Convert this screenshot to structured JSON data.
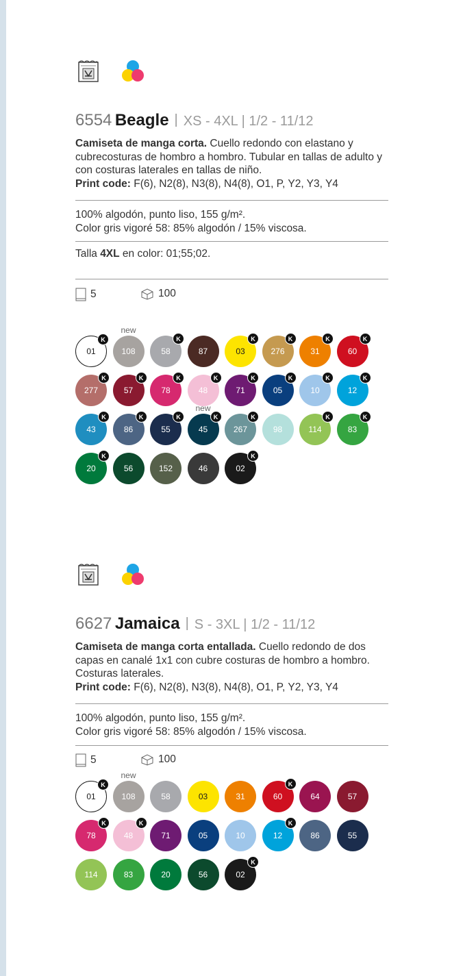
{
  "colors": {
    "stripe": "#d5e1ea",
    "rule": "#9a9a9a",
    "k_badge": "#111111"
  },
  "products": [
    {
      "icons": [
        "label-icon",
        "cmyk-color-icon"
      ],
      "code": "6554",
      "name": "Beagle",
      "separator": "|",
      "sizes": "XS - 4XL | 1/2 - 11/12",
      "desc_bold": "Camiseta de manga corta.",
      "desc_rest": " Cuello redondo con elastano y cubrecosturas de hombro a hombro. Tubular en tallas de adulto y con costuras laterales en tallas de niño.",
      "print_label": "Print code:",
      "print_value": " F(6), N2(8), N3(8), N4(8), O1, P, Y2, Y3, Y4",
      "fabric_line1": "100% algodón, punto liso, 155 g/m².",
      "fabric_line2": "Color gris vigoré 58: 85% algodón / 15% viscosa.",
      "talla_prefix": "Talla ",
      "talla_bold": "4XL",
      "talla_suffix": " en color: 01;55;02.",
      "pack_units": "5",
      "box_units": "100",
      "swatches": [
        {
          "code": "01",
          "color": "#ffffff",
          "text": "#1a1a1a",
          "k": true,
          "new": false
        },
        {
          "code": "108",
          "color": "#a7a3a0",
          "text": "#ffffff",
          "k": false,
          "new": true
        },
        {
          "code": "58",
          "color": "#a8a9ad",
          "text": "#ffffff",
          "k": true,
          "new": false
        },
        {
          "code": "87",
          "color": "#4b2a24",
          "text": "#ffffff",
          "k": false,
          "new": false
        },
        {
          "code": "03",
          "color": "#fde400",
          "text": "#1a1a1a",
          "k": true,
          "new": false
        },
        {
          "code": "276",
          "color": "#c59a50",
          "text": "#ffffff",
          "k": true,
          "new": false
        },
        {
          "code": "31",
          "color": "#ee8000",
          "text": "#ffffff",
          "k": true,
          "new": false
        },
        {
          "code": "60",
          "color": "#cf1020",
          "text": "#ffffff",
          "k": true,
          "new": false
        },
        {
          "code": "277",
          "color": "#b46e6a",
          "text": "#ffffff",
          "k": true,
          "new": false
        },
        {
          "code": "57",
          "color": "#8a1a30",
          "text": "#ffffff",
          "k": true,
          "new": false
        },
        {
          "code": "78",
          "color": "#d6296f",
          "text": "#ffffff",
          "k": true,
          "new": false
        },
        {
          "code": "48",
          "color": "#f4bfd6",
          "text": "#ffffff",
          "k": true,
          "new": false
        },
        {
          "code": "71",
          "color": "#6e1b72",
          "text": "#ffffff",
          "k": true,
          "new": false
        },
        {
          "code": "05",
          "color": "#0a3f7e",
          "text": "#ffffff",
          "k": true,
          "new": false
        },
        {
          "code": "10",
          "color": "#9fc6ea",
          "text": "#ffffff",
          "k": true,
          "new": false
        },
        {
          "code": "12",
          "color": "#00a3db",
          "text": "#ffffff",
          "k": true,
          "new": false
        },
        {
          "code": "43",
          "color": "#1f8ec0",
          "text": "#ffffff",
          "k": true,
          "new": false
        },
        {
          "code": "86",
          "color": "#4d6584",
          "text": "#ffffff",
          "k": true,
          "new": false
        },
        {
          "code": "55",
          "color": "#1b2d4d",
          "text": "#ffffff",
          "k": true,
          "new": false
        },
        {
          "code": "45",
          "color": "#063a4f",
          "text": "#ffffff",
          "k": true,
          "new": true
        },
        {
          "code": "267",
          "color": "#6c959a",
          "text": "#ffffff",
          "k": true,
          "new": false
        },
        {
          "code": "98",
          "color": "#b4e0dc",
          "text": "#ffffff",
          "k": false,
          "new": false
        },
        {
          "code": "114",
          "color": "#93c456",
          "text": "#ffffff",
          "k": true,
          "new": false
        },
        {
          "code": "83",
          "color": "#35a541",
          "text": "#ffffff",
          "k": true,
          "new": false
        },
        {
          "code": "20",
          "color": "#007a3c",
          "text": "#ffffff",
          "k": true,
          "new": false
        },
        {
          "code": "56",
          "color": "#0c4a2d",
          "text": "#ffffff",
          "k": false,
          "new": false
        },
        {
          "code": "152",
          "color": "#56604a",
          "text": "#ffffff",
          "k": false,
          "new": false
        },
        {
          "code": "46",
          "color": "#3a3a3a",
          "text": "#ffffff",
          "k": false,
          "new": false
        },
        {
          "code": "02",
          "color": "#1a1a1a",
          "text": "#ffffff",
          "k": true,
          "new": false
        }
      ]
    },
    {
      "icons": [
        "label-icon",
        "cmyk-color-icon"
      ],
      "code": "6627",
      "name": "Jamaica",
      "separator": "|",
      "sizes": "S - 3XL | 1/2 - 11/12",
      "desc_bold": "Camiseta de manga corta entallada.",
      "desc_rest": " Cuello redondo de dos capas en canalé 1x1 con cubre costuras de hombro a hombro. Costuras laterales.",
      "print_label": "Print code:",
      "print_value": " F(6), N2(8), N3(8), N4(8), O1, P, Y2, Y3, Y4",
      "fabric_line1": "100% algodón, punto liso, 155 g/m².",
      "fabric_line2": "Color gris vigoré 58: 85% algodón / 15% viscosa.",
      "pack_units": "5",
      "box_units": "100",
      "swatches": [
        {
          "code": "01",
          "color": "#ffffff",
          "text": "#1a1a1a",
          "k": true,
          "new": false
        },
        {
          "code": "108",
          "color": "#a7a3a0",
          "text": "#ffffff",
          "k": false,
          "new": true
        },
        {
          "code": "58",
          "color": "#a8a9ad",
          "text": "#ffffff",
          "k": false,
          "new": false
        },
        {
          "code": "03",
          "color": "#fde400",
          "text": "#1a1a1a",
          "k": false,
          "new": false
        },
        {
          "code": "31",
          "color": "#ee8000",
          "text": "#ffffff",
          "k": false,
          "new": false
        },
        {
          "code": "60",
          "color": "#cf1020",
          "text": "#ffffff",
          "k": true,
          "new": false
        },
        {
          "code": "64",
          "color": "#9a1450",
          "text": "#ffffff",
          "k": false,
          "new": false
        },
        {
          "code": "57",
          "color": "#8a1a30",
          "text": "#ffffff",
          "k": false,
          "new": false
        },
        {
          "code": "78",
          "color": "#d6296f",
          "text": "#ffffff",
          "k": true,
          "new": false
        },
        {
          "code": "48",
          "color": "#f4bfd6",
          "text": "#ffffff",
          "k": true,
          "new": false
        },
        {
          "code": "71",
          "color": "#6e1b72",
          "text": "#ffffff",
          "k": false,
          "new": false
        },
        {
          "code": "05",
          "color": "#0a3f7e",
          "text": "#ffffff",
          "k": false,
          "new": false
        },
        {
          "code": "10",
          "color": "#9fc6ea",
          "text": "#ffffff",
          "k": false,
          "new": false
        },
        {
          "code": "12",
          "color": "#00a3db",
          "text": "#ffffff",
          "k": true,
          "new": false
        },
        {
          "code": "86",
          "color": "#4d6584",
          "text": "#ffffff",
          "k": false,
          "new": false
        },
        {
          "code": "55",
          "color": "#1b2d4d",
          "text": "#ffffff",
          "k": false,
          "new": false
        },
        {
          "code": "114",
          "color": "#93c456",
          "text": "#ffffff",
          "k": false,
          "new": false
        },
        {
          "code": "83",
          "color": "#35a541",
          "text": "#ffffff",
          "k": false,
          "new": false
        },
        {
          "code": "20",
          "color": "#007a3c",
          "text": "#ffffff",
          "k": false,
          "new": false
        },
        {
          "code": "56",
          "color": "#0c4a2d",
          "text": "#ffffff",
          "k": false,
          "new": false
        },
        {
          "code": "02",
          "color": "#1a1a1a",
          "text": "#ffffff",
          "k": true,
          "new": false
        }
      ]
    }
  ],
  "badge_letter": "K",
  "new_label": "new"
}
